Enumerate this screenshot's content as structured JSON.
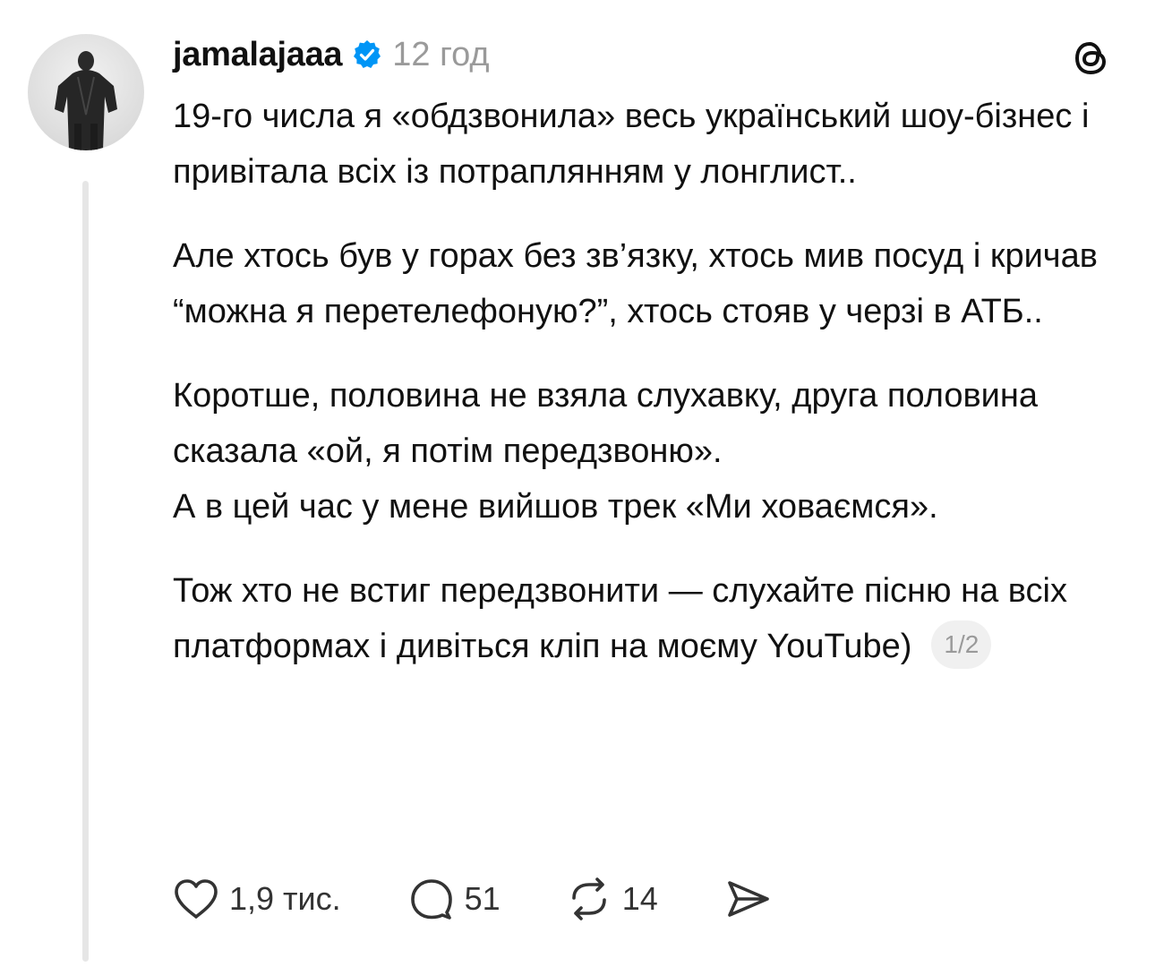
{
  "post": {
    "username": "jamalajaaa",
    "timestamp": "12 год",
    "paragraphs": {
      "p1": "19-го числа я «обдзвонила» весь український шоу-бізнес і привітала всіх із потраплянням у лонглист..",
      "p2": "Але хтось був у горах без зв’язку, хтось мив посуд і кричав “можна я перетелефоную?”, хтось стояв у черзі в АТБ..",
      "p3a": "Коротше, половина не взяла слухавку, друга половина сказала «ой, я потім передзвоню».",
      "p3b": "А в цей час у мене вийшов трек «Ми ховаємся».",
      "p4": "Тож хто не встиг передзвонити — слухайте пісню на всіх платформах і дивіться кліп на моєму YouTube)"
    },
    "pager": "1/2"
  },
  "actions": {
    "likes": "1,9 тис.",
    "replies": "51",
    "reposts": "14"
  },
  "icons": {
    "verified": "verified-badge-icon",
    "app": "threads-logo-icon",
    "like": "heart-icon",
    "reply": "comment-icon",
    "repost": "repost-icon",
    "share": "send-icon"
  },
  "colors": {
    "verified": "#0095f6",
    "muted": "#9a9a9a",
    "thread_line": "#e6e6e6"
  }
}
